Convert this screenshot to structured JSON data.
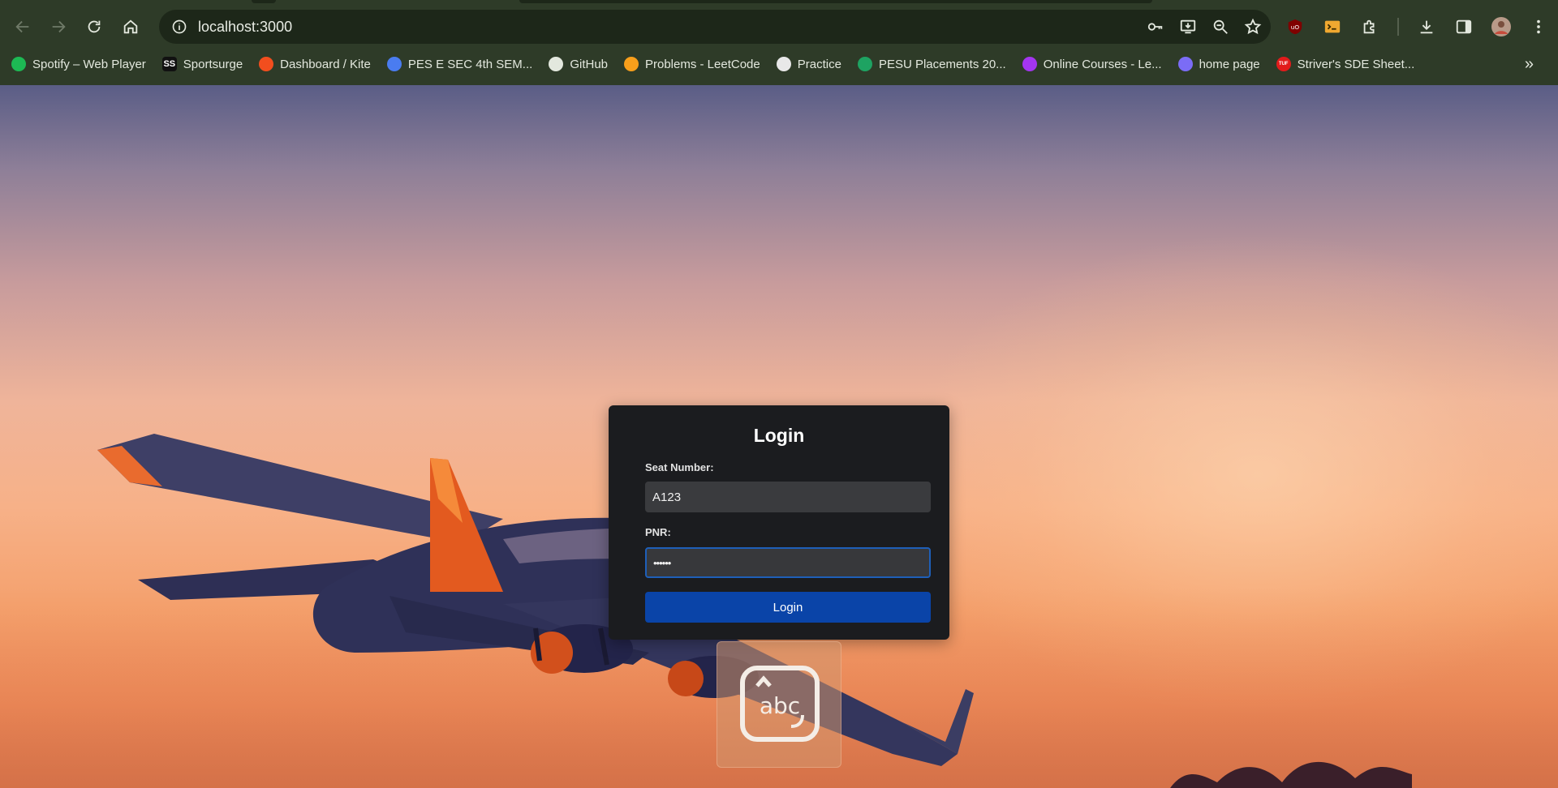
{
  "browser": {
    "url": "localhost:3000",
    "bookmarks": [
      {
        "label": "Spotify – Web Player",
        "icon": "spotify-icon",
        "color": "#1db954"
      },
      {
        "label": "Sportsurge",
        "icon": "sportsurge-icon",
        "color": "#111111",
        "glyph": "SS"
      },
      {
        "label": "Dashboard / Kite",
        "icon": "kite-icon",
        "color": "#f24e1e"
      },
      {
        "label": "PES E SEC 4th SEM...",
        "icon": "people-icon",
        "color": "#4a7cf0"
      },
      {
        "label": "GitHub",
        "icon": "github-icon",
        "color": "#ffffff"
      },
      {
        "label": "Problems - LeetCode",
        "icon": "leetcode-icon",
        "color": "#f89f1b"
      },
      {
        "label": "Practice",
        "icon": "practice-icon",
        "color": "#e8e8e8"
      },
      {
        "label": "PESU Placements 20...",
        "icon": "sheets-icon",
        "color": "#1ea362"
      },
      {
        "label": "Online Courses - Le...",
        "icon": "udemy-icon",
        "color": "#a435f0"
      },
      {
        "label": "home page",
        "icon": "cloud-icon",
        "color": "#7b6cf6"
      },
      {
        "label": "Striver's SDE Sheet...",
        "icon": "tuf-icon",
        "color": "#e21b1b",
        "glyph": "TUF"
      }
    ]
  },
  "login": {
    "title": "Login",
    "seat_label": "Seat Number:",
    "seat_value": "A123",
    "pnr_label": "PNR:",
    "pnr_value": "••••••",
    "button_label": "Login"
  },
  "ime": {
    "text": "abc"
  }
}
